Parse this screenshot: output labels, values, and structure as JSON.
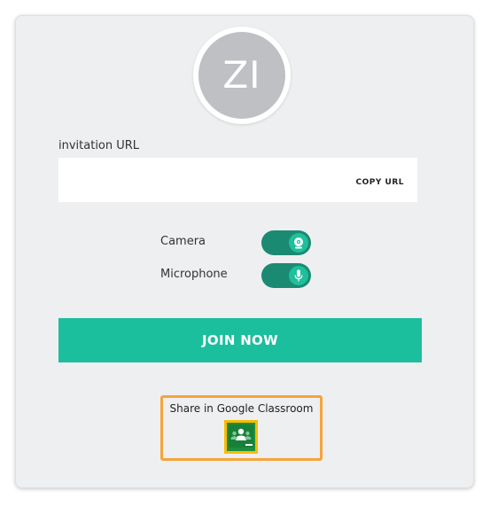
{
  "user": {
    "initials": "ZI"
  },
  "invitation": {
    "label": "invitation URL",
    "url_value": "",
    "copy_label": "COPY URL"
  },
  "devices": {
    "camera_label": "Camera",
    "camera_on": true,
    "microphone_label": "Microphone",
    "microphone_on": true
  },
  "actions": {
    "join_label": "JOIN NOW"
  },
  "share": {
    "label": "Share in Google Classroom",
    "icon": "google-classroom-icon"
  },
  "colors": {
    "accent": "#1bbe9d",
    "toggle_track": "#1b8a72",
    "toggle_knob": "#1fbf9c",
    "highlight": "#f5a53a",
    "classroom_green": "#1e8e3e",
    "classroom_border": "#fbbc04"
  }
}
